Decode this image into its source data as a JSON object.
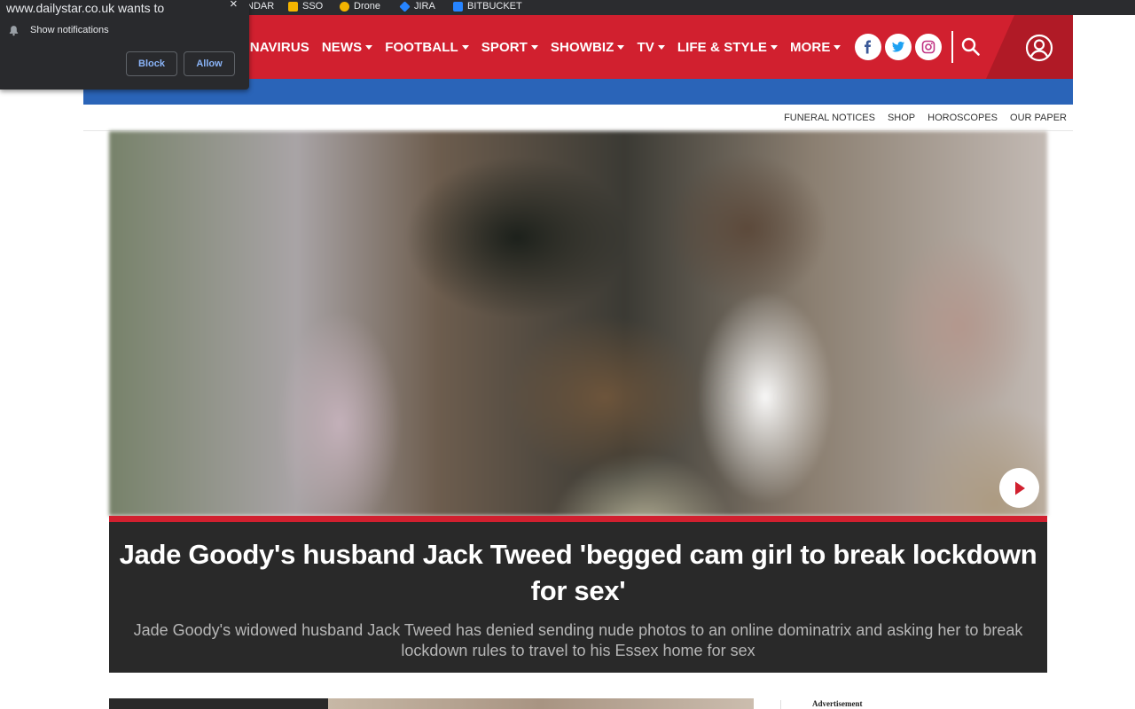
{
  "browser": {
    "bookmarks": [
      {
        "label": "NDAR",
        "icon": "calendar-icon",
        "color": "#4285f4"
      },
      {
        "label": "SSO",
        "icon": "folder-icon",
        "color": "#f4b400"
      },
      {
        "label": "Drone",
        "icon": "drone-icon",
        "color": "#f4b400"
      },
      {
        "label": "JIRA",
        "icon": "jira-icon",
        "color": "#2684ff"
      },
      {
        "label": "BITBUCKET",
        "icon": "bitbucket-icon",
        "color": "#2684ff"
      }
    ]
  },
  "permission_popup": {
    "title": "www.dailystar.co.uk wants to",
    "close_symbol": "×",
    "request": "Show notifications",
    "block_label": "Block",
    "allow_label": "Allow"
  },
  "site": {
    "brand_color": "#d1202f",
    "secondary_color": "#2a64b8",
    "nav": [
      {
        "label": "ONAVIRUS",
        "has_dropdown": false
      },
      {
        "label": "NEWS",
        "has_dropdown": true
      },
      {
        "label": "FOOTBALL",
        "has_dropdown": true
      },
      {
        "label": "SPORT",
        "has_dropdown": true
      },
      {
        "label": "SHOWBIZ",
        "has_dropdown": true
      },
      {
        "label": "TV",
        "has_dropdown": true
      },
      {
        "label": "LIFE & STYLE",
        "has_dropdown": true
      },
      {
        "label": "MORE",
        "has_dropdown": true
      }
    ],
    "social": [
      {
        "icon": "facebook-icon",
        "color": "#3b5998"
      },
      {
        "icon": "twitter-icon",
        "color": "#1da1f2"
      },
      {
        "icon": "instagram-icon",
        "color": "#c13584"
      }
    ],
    "utility_links": [
      "FUNERAL NOTICES",
      "SHOP",
      "HOROSCOPES",
      "OUR PAPER"
    ]
  },
  "hero": {
    "headline": "Jade Goody's husband Jack Tweed 'begged cam girl to break lockdown for sex'",
    "standfirst": "Jade Goody's widowed husband Jack Tweed has denied sending nude photos to an online dominatrix and asking her to break lockdown rules to travel to his Essex home for sex"
  },
  "sidebar": {
    "ad_label": "Advertisement"
  }
}
